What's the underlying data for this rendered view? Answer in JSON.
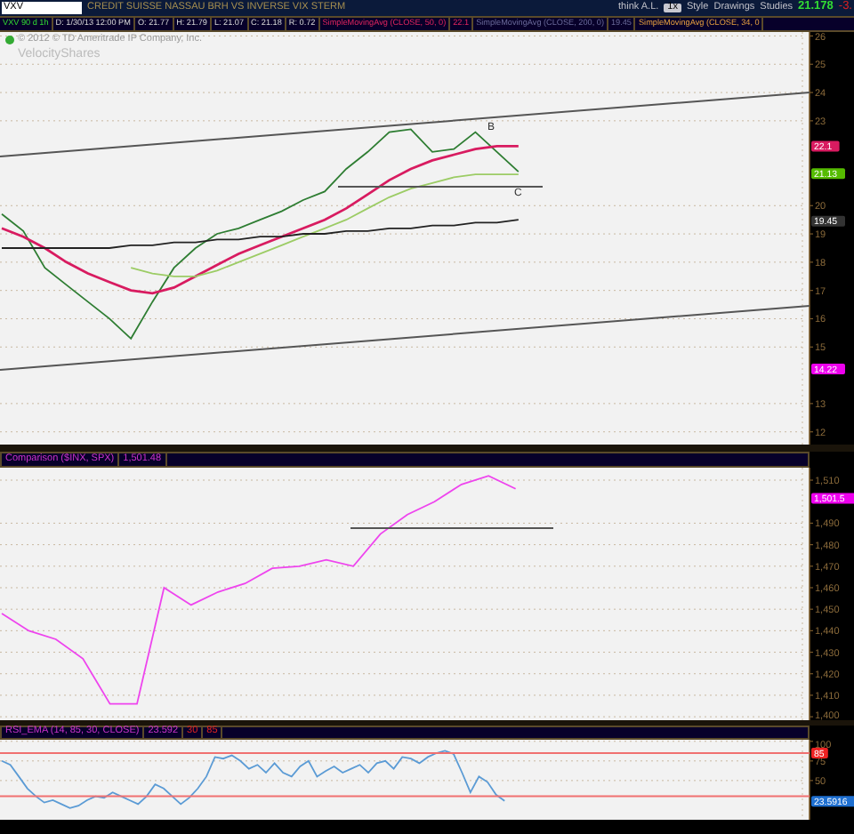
{
  "toolbar": {
    "symbol": "VXV",
    "description": "CREDIT SUISSE NASSAU BRH VS INVERSE VIX STERM",
    "buttons": [
      "think A.L.",
      "1x",
      "Style",
      "Drawings",
      "Studies"
    ],
    "last_price": "21.178",
    "change": "-3."
  },
  "info_bar": [
    {
      "text": "VXV 90 d 1h",
      "kind": "symbol"
    },
    {
      "text": "D: 1/30/13 12:00 PM",
      "kind": "field"
    },
    {
      "text": "O: 21.77",
      "kind": "field"
    },
    {
      "text": "H: 21.79",
      "kind": "field"
    },
    {
      "text": "L: 21.07",
      "kind": "field"
    },
    {
      "text": "C: 21.18",
      "kind": "field"
    },
    {
      "text": "R: 0.72",
      "kind": "field"
    },
    {
      "text": "SimpleMovingAvg (CLOSE, 50, 0)",
      "kind": "sma50"
    },
    {
      "text": "22.1",
      "kind": "sma50"
    },
    {
      "text": "SimpleMovingAvg (CLOSE, 200, 0)",
      "kind": "sma200"
    },
    {
      "text": "19.45",
      "kind": "sma200"
    },
    {
      "text": "SimpleMovingAvg (CLOSE, 34, 0",
      "kind": "sma34"
    }
  ],
  "main_chart": {
    "copyright": "© 2012 © TD Ameritrade IP Company, Inc.",
    "brand": "VelocityShares",
    "drawing_labels": [
      "B",
      "C"
    ],
    "price_tags": [
      {
        "text": "22.1",
        "color": "#d81b60"
      },
      {
        "text": "21.13",
        "color": "#55bb00"
      },
      {
        "text": "19.45",
        "color": "#333333"
      },
      {
        "text": "14.22",
        "color": "#ee00ee"
      }
    ],
    "chart_data": {
      "type": "line",
      "ylim": [
        11.55,
        26.14
      ],
      "yticks": [
        12,
        13,
        15,
        16,
        17,
        18,
        19,
        20,
        23,
        24,
        25,
        26
      ],
      "grid": true,
      "series": [
        {
          "color": "#2e7d32",
          "values": [
            19.7,
            19.1,
            17.8,
            17.2,
            16.6,
            16.0,
            15.3,
            16.6,
            17.8,
            18.5,
            19.0,
            19.2,
            19.5,
            19.8,
            20.2,
            20.5,
            21.3,
            21.9,
            22.6,
            22.7,
            21.9,
            22.0,
            22.6,
            21.9,
            21.2
          ]
        },
        {
          "color": "#d81b60",
          "values": [
            19.2,
            18.9,
            18.5,
            18.0,
            17.6,
            17.3,
            17.0,
            16.9,
            17.1,
            17.5,
            17.9,
            18.3,
            18.6,
            18.9,
            19.2,
            19.5,
            19.9,
            20.4,
            20.9,
            21.3,
            21.6,
            21.8,
            22.0,
            22.1,
            22.1
          ]
        },
        {
          "color": "#9ccc65",
          "values": [
            null,
            null,
            null,
            null,
            null,
            null,
            17.8,
            17.6,
            17.5,
            17.5,
            17.7,
            18.0,
            18.3,
            18.6,
            18.9,
            19.2,
            19.5,
            19.9,
            20.3,
            20.6,
            20.8,
            21.0,
            21.1,
            21.1,
            21.1
          ]
        },
        {
          "color": "#222222",
          "values": [
            18.5,
            18.5,
            18.5,
            18.5,
            18.5,
            18.5,
            18.6,
            18.6,
            18.7,
            18.7,
            18.8,
            18.8,
            18.9,
            18.9,
            19.0,
            19.0,
            19.1,
            19.1,
            19.2,
            19.2,
            19.3,
            19.3,
            19.4,
            19.4,
            19.5
          ]
        }
      ]
    }
  },
  "comparison": {
    "title": "Comparison ($INX, SPX)",
    "reading": "1,501.48",
    "price_tags": [
      {
        "text": "1,501.5",
        "color": "#ee00ee"
      }
    ],
    "chart_data": {
      "type": "line",
      "ylim": [
        1398.4,
        1515.8
      ],
      "grid": true,
      "yticks": [
        {
          "value": 1510,
          "label": "1,510"
        },
        {
          "value": 1490,
          "label": "1,490"
        },
        {
          "value": 1480,
          "label": "1,480"
        },
        {
          "value": 1470,
          "label": "1,470"
        },
        {
          "value": 1460,
          "label": "1,460"
        },
        {
          "value": 1450,
          "label": "1,450"
        },
        {
          "value": 1440,
          "label": "1,440"
        },
        {
          "value": 1430,
          "label": "1,430"
        },
        {
          "value": 1420,
          "label": "1,420"
        },
        {
          "value": 1410,
          "label": "1,410"
        },
        {
          "value": 1400,
          "label": "1,400"
        }
      ],
      "series": [
        {
          "color": "#ee44ee",
          "values": [
            1448,
            1440,
            1436,
            1427,
            1406,
            1406,
            1460,
            1452,
            1458,
            1462,
            1469,
            1470,
            1473,
            1470,
            1485,
            1494,
            1500,
            1508,
            1512,
            1506
          ]
        }
      ]
    }
  },
  "rsi": {
    "title": "RSI_EMA (14, 85, 30, CLOSE)",
    "reading": "23.592",
    "levels": [
      "30",
      "85"
    ],
    "price_tags": [
      {
        "text": "85",
        "color": "#ee2222"
      },
      {
        "text": "23.5916",
        "color": "#1e6fd0"
      }
    ],
    "chart_data": {
      "type": "line",
      "ylim": [
        0,
        102
      ],
      "yticks": [
        100,
        75,
        50
      ],
      "grid": true,
      "series": [
        {
          "color": "#5b9bd5",
          "values": [
            75,
            70,
            55,
            40,
            30,
            22,
            25,
            20,
            15,
            18,
            25,
            30,
            28,
            35,
            30,
            25,
            20,
            30,
            45,
            40,
            30,
            20,
            28,
            40,
            55,
            80,
            78,
            82,
            75,
            65,
            70,
            60,
            72,
            60,
            55,
            68,
            75,
            55,
            62,
            68,
            60,
            65,
            70,
            60,
            72,
            75,
            65,
            80,
            78,
            72,
            80,
            85,
            88,
            84,
            60,
            35,
            55,
            48,
            32,
            24
          ]
        }
      ]
    }
  }
}
